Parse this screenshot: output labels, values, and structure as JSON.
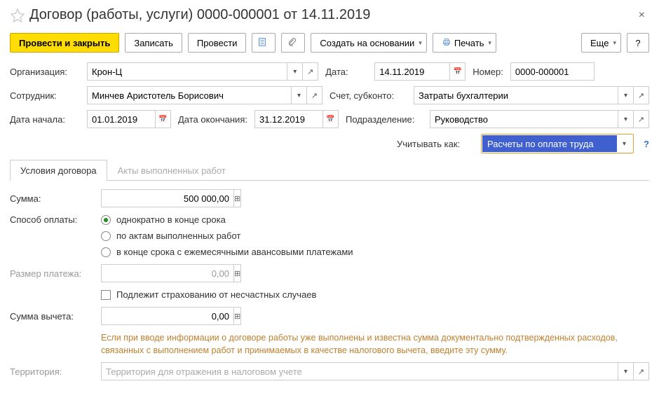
{
  "header": {
    "title": "Договор (работы, услуги) 0000-000001 от 14.11.2019"
  },
  "toolbar": {
    "post_close": "Провести и закрыть",
    "save": "Записать",
    "post": "Провести",
    "create_by": "Создать на основании",
    "print": "Печать",
    "more": "Еще",
    "help": "?"
  },
  "form": {
    "org_label": "Организация:",
    "org_value": "Крон-Ц",
    "date_label": "Дата:",
    "date_value": "14.11.2019",
    "number_label": "Номер:",
    "number_value": "0000-000001",
    "employee_label": "Сотрудник:",
    "employee_value": "Минчев Аристотель Борисович",
    "account_label": "Счет, субконто:",
    "account_value": "Затраты бухгалтерии",
    "start_label": "Дата начала:",
    "start_value": "01.01.2019",
    "end_label": "Дата окончания:",
    "end_value": "31.12.2019",
    "dept_label": "Подразделение:",
    "dept_value": "Руководство",
    "treat_label": "Учитывать как:",
    "treat_value": "Расчеты по оплате труда"
  },
  "tabs": {
    "conditions": "Условия договора",
    "acts": "Акты выполненных работ"
  },
  "conditions": {
    "sum_label": "Сумма:",
    "sum_value": "500 000,00",
    "pay_label": "Способ оплаты:",
    "pay_opt1": "однократно в конце срока",
    "pay_opt2": "по актам выполненных работ",
    "pay_opt3": "в конце срока с ежемесячными авансовыми платежами",
    "payment_size_label": "Размер платежа:",
    "payment_size_value": "0,00",
    "insurance_label": "Подлежит страхованию от несчастных случаев",
    "deduction_label": "Сумма вычета:",
    "deduction_value": "0,00",
    "hint": "Если при вводе информации о договоре работы уже выполнены и известна сумма документально подтвержденных расходов, связанных с выполнением работ и принимаемых в качестве налогового вычета, введите эту сумму.",
    "territory_label": "Территория:",
    "territory_placeholder": "Территория для отражения в налоговом учете"
  }
}
